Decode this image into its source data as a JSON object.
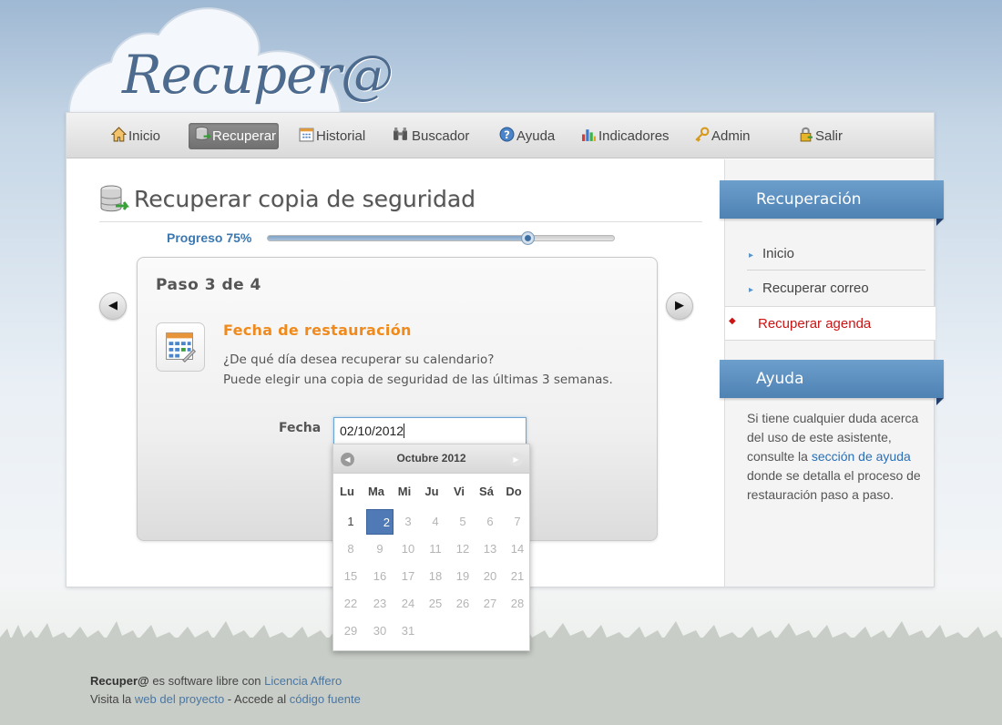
{
  "app": {
    "logo": "Recuper@"
  },
  "nav": {
    "items": [
      {
        "label": "Inicio",
        "icon": "home-icon"
      },
      {
        "label": "Recuperar",
        "icon": "database-icon",
        "active": true
      },
      {
        "label": "Historial",
        "icon": "calendar-icon"
      },
      {
        "label": "Buscador",
        "icon": "binoculars-icon"
      },
      {
        "label": "Ayuda",
        "icon": "help-icon"
      },
      {
        "label": "Indicadores",
        "icon": "chart-icon"
      },
      {
        "label": "Admin",
        "icon": "key-icon"
      },
      {
        "label": "Salir",
        "icon": "lock-icon"
      }
    ]
  },
  "page": {
    "title": "Recuperar copia de seguridad"
  },
  "progress": {
    "label": "Progreso 75%",
    "value": 0.75
  },
  "step": {
    "title": "Paso 3 de 4",
    "section_title": "Fecha de restauración",
    "question": "¿De qué día desea recuperar su calendario?",
    "hint": "Puede elegir una copia de seguridad de las últimas 3 semanas.",
    "date_label": "Fecha",
    "date_value": "02/10/2012"
  },
  "datepicker": {
    "title": "Octubre 2012",
    "weekdays": [
      "Lu",
      "Ma",
      "Mi",
      "Ju",
      "Vi",
      "Sá",
      "Do"
    ],
    "weeks": [
      [
        "1",
        "2",
        "3",
        "4",
        "5",
        "6",
        "7"
      ],
      [
        "8",
        "9",
        "10",
        "11",
        "12",
        "13",
        "14"
      ],
      [
        "15",
        "16",
        "17",
        "18",
        "19",
        "20",
        "21"
      ],
      [
        "22",
        "23",
        "24",
        "25",
        "26",
        "27",
        "28"
      ],
      [
        "29",
        "30",
        "31",
        "",
        "",
        "",
        ""
      ]
    ],
    "enabled_days": [
      "1",
      "2"
    ],
    "selected_day": "2"
  },
  "sidebar": {
    "recovery_heading": "Recuperación",
    "links": [
      {
        "label": "Inicio"
      },
      {
        "label": "Recuperar correo"
      },
      {
        "label": "Recuperar agenda",
        "active": true
      }
    ],
    "help_heading": "Ayuda",
    "help_text_before": "Si tiene cualquier duda acerca del uso de este asistente, consulte la",
    "help_link": "sección de ayuda",
    "help_text_after": "donde se detalla el proceso de restauración paso a paso."
  },
  "footer": {
    "brand": "Recuper@",
    "line1_text": " es software libre con ",
    "license_link": "Licencia Affero",
    "line2_prefix": "Visita la ",
    "project_link": "web del proyecto",
    "line2_mid": " - Accede al ",
    "source_link": "código fuente"
  },
  "colors": {
    "accent_blue": "#4f7ab5",
    "section_orange": "#f08a1c",
    "active_red": "#cc1414",
    "link_blue": "#2a6fb6"
  }
}
